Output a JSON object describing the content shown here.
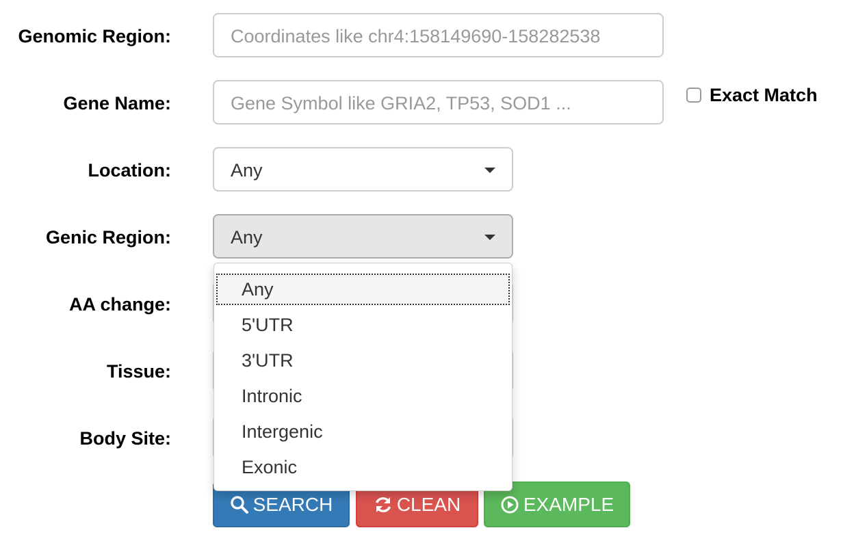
{
  "form": {
    "genomic_region": {
      "label": "Genomic Region:",
      "placeholder": "Coordinates like chr4:158149690-158282538"
    },
    "gene_name": {
      "label": "Gene Name:",
      "placeholder": "Gene Symbol like GRIA2, TP53, SOD1 ...",
      "exact_match_label": "Exact Match",
      "exact_match_checked": false
    },
    "location": {
      "label": "Location:",
      "value": "Any"
    },
    "genic_region": {
      "label": "Genic Region:",
      "value": "Any",
      "options": [
        "Any",
        "5'UTR",
        "3'UTR",
        "Intronic",
        "Intergenic",
        "Exonic"
      ],
      "highlighted_option": "Any"
    },
    "aa_change": {
      "label": "AA change:"
    },
    "tissue": {
      "label": "Tissue:"
    },
    "body_site": {
      "label": "Body Site:"
    }
  },
  "buttons": {
    "search": {
      "label": "SEARCH",
      "icon": "search-icon",
      "color": "#337ab7"
    },
    "clean": {
      "label": "CLEAN",
      "icon": "refresh-icon",
      "color": "#d9534f"
    },
    "example": {
      "label": "EXAMPLE",
      "icon": "play-circle-icon",
      "color": "#5cb85c"
    }
  }
}
